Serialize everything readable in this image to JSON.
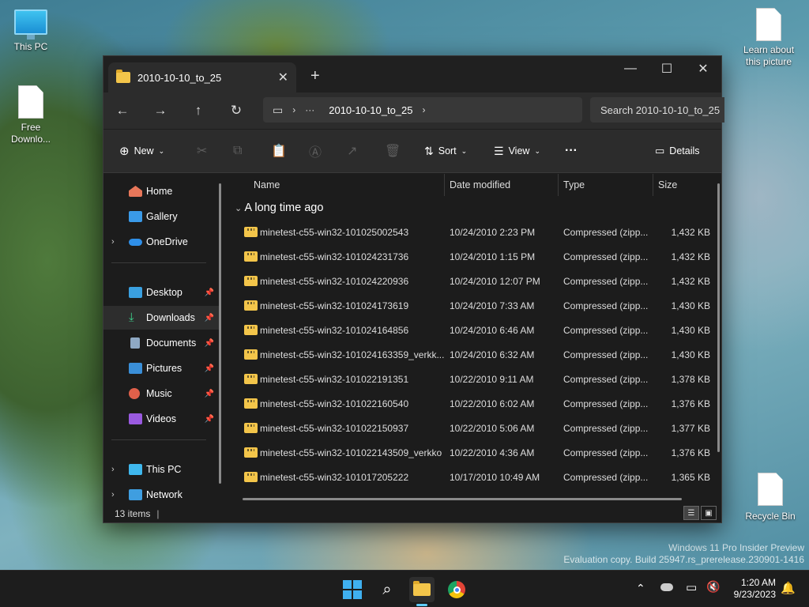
{
  "desktop": {
    "icons": {
      "this_pc": "This PC",
      "free_download": "Free Downlo...",
      "learn_picture": "Learn about this picture",
      "recycle_bin": "Recycle Bin"
    },
    "watermark": {
      "line1": "Windows 11 Pro Insider Preview",
      "line2": "Evaluation copy. Build 25947.rs_prerelease.230901-1416"
    }
  },
  "window": {
    "tab_title": "2010-10-10_to_25",
    "address": {
      "ellipsis": "···",
      "path": "2010-10-10_to_25"
    },
    "search_placeholder": "Search 2010-10-10_to_25",
    "toolbar": {
      "new_label": "New",
      "sort_label": "Sort",
      "view_label": "View",
      "more_label": "···",
      "details_label": "Details"
    },
    "sidebar": {
      "home": "Home",
      "gallery": "Gallery",
      "onedrive": "OneDrive",
      "desktop": "Desktop",
      "downloads": "Downloads",
      "documents": "Documents",
      "pictures": "Pictures",
      "music": "Music",
      "videos": "Videos",
      "this_pc": "This PC",
      "network": "Network"
    },
    "columns": {
      "name": "Name",
      "date": "Date modified",
      "type": "Type",
      "size": "Size"
    },
    "group_label": "A long time ago",
    "files": [
      {
        "name": "minetest-c55-win32-101025002543",
        "date": "10/24/2010 2:23 PM",
        "type": "Compressed (zipp...",
        "size": "1,432 KB"
      },
      {
        "name": "minetest-c55-win32-101024231736",
        "date": "10/24/2010 1:15 PM",
        "type": "Compressed (zipp...",
        "size": "1,432 KB"
      },
      {
        "name": "minetest-c55-win32-101024220936",
        "date": "10/24/2010 12:07 PM",
        "type": "Compressed (zipp...",
        "size": "1,432 KB"
      },
      {
        "name": "minetest-c55-win32-101024173619",
        "date": "10/24/2010 7:33 AM",
        "type": "Compressed (zipp...",
        "size": "1,430 KB"
      },
      {
        "name": "minetest-c55-win32-101024164856",
        "date": "10/24/2010 6:46 AM",
        "type": "Compressed (zipp...",
        "size": "1,430 KB"
      },
      {
        "name": "minetest-c55-win32-101024163359_verkk...",
        "date": "10/24/2010 6:32 AM",
        "type": "Compressed (zipp...",
        "size": "1,430 KB"
      },
      {
        "name": "minetest-c55-win32-101022191351",
        "date": "10/22/2010 9:11 AM",
        "type": "Compressed (zipp...",
        "size": "1,378 KB"
      },
      {
        "name": "minetest-c55-win32-101022160540",
        "date": "10/22/2010 6:02 AM",
        "type": "Compressed (zipp...",
        "size": "1,376 KB"
      },
      {
        "name": "minetest-c55-win32-101022150937",
        "date": "10/22/2010 5:06 AM",
        "type": "Compressed (zipp...",
        "size": "1,377 KB"
      },
      {
        "name": "minetest-c55-win32-101022143509_verkko",
        "date": "10/22/2010 4:36 AM",
        "type": "Compressed (zipp...",
        "size": "1,376 KB"
      },
      {
        "name": "minetest-c55-win32-101017205222",
        "date": "10/17/2010 10:49 AM",
        "type": "Compressed (zipp...",
        "size": "1,365 KB"
      }
    ],
    "status": {
      "item_count": "13 items"
    }
  },
  "taskbar": {
    "time": "1:20 AM",
    "date": "9/23/2023"
  },
  "colors": {
    "window_bg": "#1c1c1c",
    "accent": "#60cdff",
    "folder": "#f3c54a"
  }
}
